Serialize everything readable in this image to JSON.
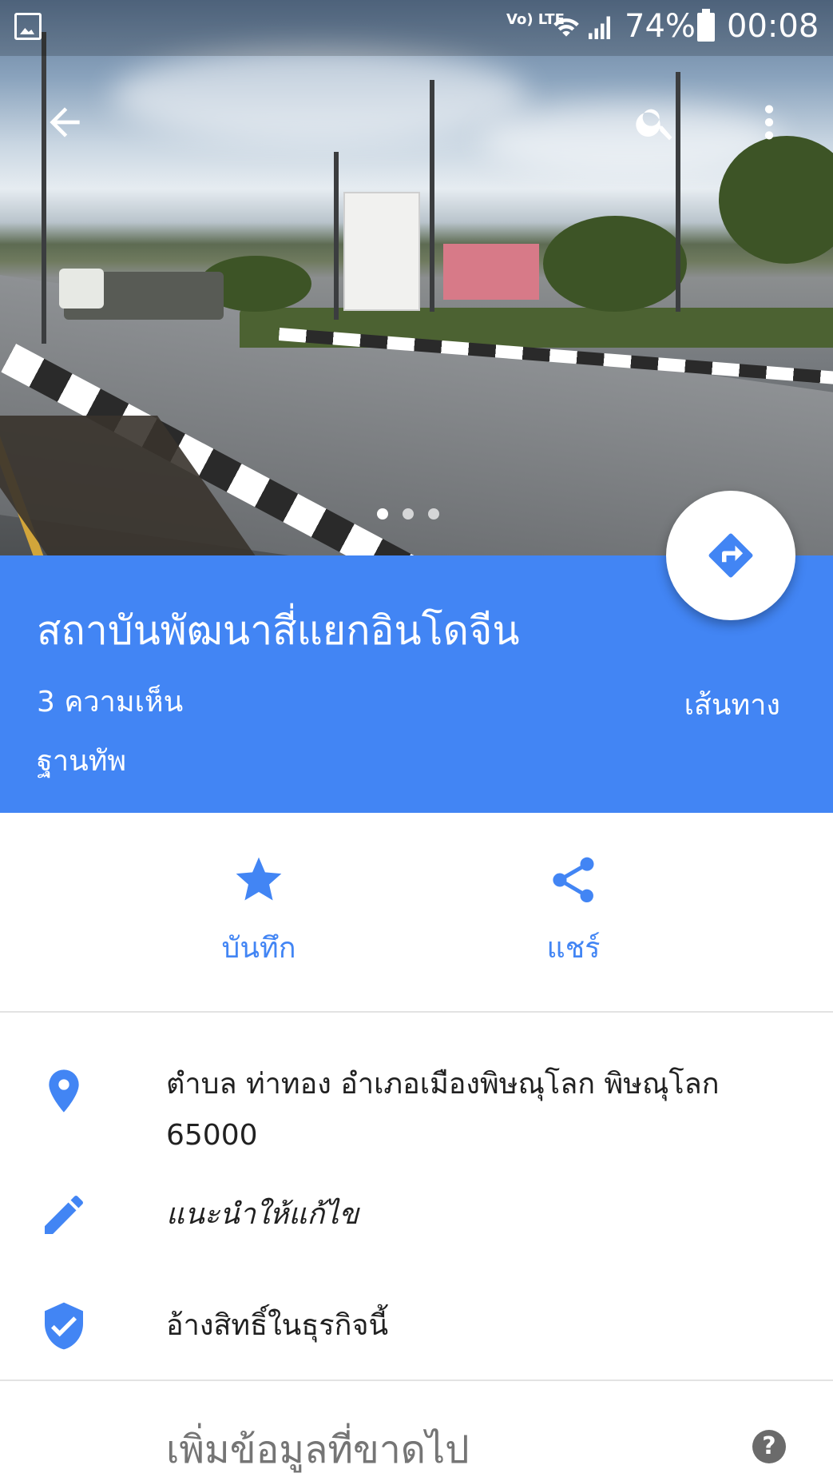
{
  "status_bar": {
    "network": "Vo) LTE",
    "battery": "74%",
    "time": "00:08"
  },
  "place": {
    "name": "สถาบันพัฒนาสี่แยกอินโดจีน",
    "reviews": "3 ความเห็น",
    "category": "ฐานทัพ",
    "directions_label": "เส้นทาง"
  },
  "actions": {
    "save_label": "บันทึก",
    "share_label": "แชร์"
  },
  "details": {
    "address": "ตำบล ท่าทอง อำเภอเมืองพิษณุโลก พิษณุโลก 65000",
    "suggest_edit": "แนะนำให้แก้ไข",
    "claim_business": "อ้างสิทธิ์ในธุรกิจนี้"
  },
  "missing_info": {
    "title": "เพิ่มข้อมูลที่ขาดไป",
    "help": "?"
  },
  "photo_pager": {
    "count": 3,
    "current": 1
  },
  "colors": {
    "accent": "#4285f4",
    "text_primary": "#212121",
    "text_secondary": "#757575"
  },
  "icons": {
    "back": "arrow-left-icon",
    "search": "search-icon",
    "more": "more-vert-icon",
    "directions": "directions-icon",
    "save": "star-icon",
    "share": "share-icon",
    "address": "location-pin-icon",
    "edit": "pencil-icon",
    "claim": "verified-shield-icon",
    "help": "help-circle-icon"
  }
}
